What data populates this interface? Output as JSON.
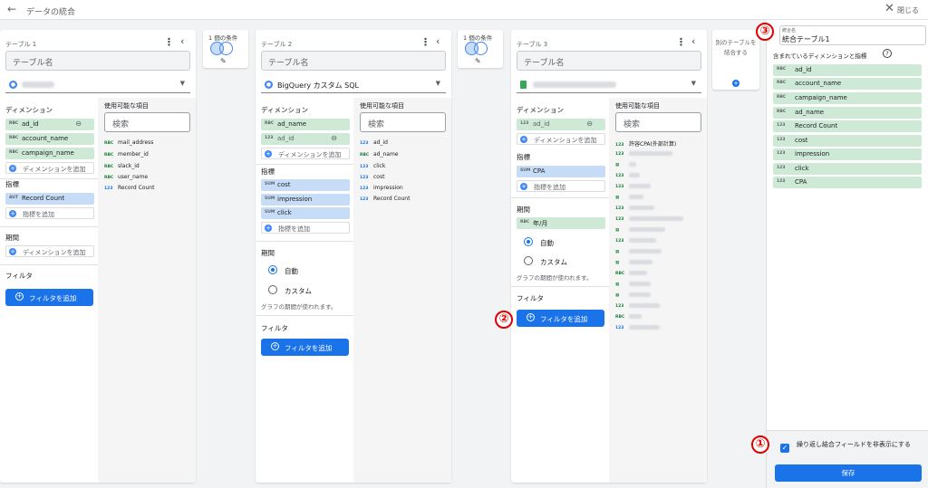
{
  "header": {
    "back_icon": "←",
    "title": "データの統合",
    "close_icon": "✕",
    "close_label": "閉じる"
  },
  "common": {
    "table_name_placeholder": "テーブル名",
    "dimension": "ディメンション",
    "available": "使用可能な項目",
    "search_placeholder": "検索",
    "add_dimension": "ディメンションを追加",
    "metric": "指標",
    "add_metric": "指標を追加",
    "period": "期間",
    "filter": "フィルタ",
    "add_filter": "フィルタを追加",
    "auto": "自動",
    "custom": "カスタム",
    "graph_period": "グラフの期間が使われます。"
  },
  "table1": {
    "title": "テーブル 1",
    "dims": [
      {
        "type": "RBC",
        "name": "ad_id"
      },
      {
        "type": "RBC",
        "name": "account_name"
      },
      {
        "type": "RBC",
        "name": "campaign_name"
      }
    ],
    "metrics": [
      {
        "type": "AUT",
        "name": "Record Count"
      }
    ],
    "fields": [
      {
        "type": "RBC",
        "name": "mail_address"
      },
      {
        "type": "RBC",
        "name": "member_id"
      },
      {
        "type": "RBC",
        "name": "slack_id"
      },
      {
        "type": "RBC",
        "name": "user_name"
      },
      {
        "type": "123",
        "name": "Record Count"
      }
    ]
  },
  "cond1": {
    "label": "1 個の条件"
  },
  "table2": {
    "title": "テーブル 2",
    "source": "BigQuery カスタム SQL",
    "dims": [
      {
        "type": "RBC",
        "name": "ad_name"
      },
      {
        "type": "123",
        "name": "ad_id"
      }
    ],
    "metrics": [
      {
        "type": "SUM",
        "name": "cost"
      },
      {
        "type": "SUM",
        "name": "impression"
      },
      {
        "type": "SUM",
        "name": "click"
      }
    ],
    "fields": [
      {
        "type": "123",
        "name": "ad_id"
      },
      {
        "type": "RBC",
        "name": "ad_name"
      },
      {
        "type": "123",
        "name": "click"
      },
      {
        "type": "123",
        "name": "cost"
      },
      {
        "type": "123",
        "name": "impression"
      },
      {
        "type": "123",
        "name": "Record Count"
      }
    ]
  },
  "cond2": {
    "label": "1 個の条件"
  },
  "table3": {
    "title": "テーブル 3",
    "dims": [
      {
        "type": "123",
        "name": "ad_id"
      }
    ],
    "metrics": [
      {
        "type": "SUM",
        "name": "CPA"
      }
    ],
    "period_field": {
      "type": "RBC",
      "name": "年/月"
    },
    "fields_first": {
      "type": "123",
      "name": "許容CPA(外部計算)"
    }
  },
  "addtable": {
    "label": "別のテーブルを結合する"
  },
  "right": {
    "name_label": "統合名",
    "name_value": "統合テーブル1",
    "included_label": "含まれているディメンションと指標",
    "help_icon": "?",
    "items": [
      {
        "type": "RBC",
        "name": "ad_id"
      },
      {
        "type": "RBC",
        "name": "account_name"
      },
      {
        "type": "RBC",
        "name": "campaign_name"
      },
      {
        "type": "RBC",
        "name": "ad_name"
      },
      {
        "type": "123",
        "name": "Record Count"
      },
      {
        "type": "123",
        "name": "cost"
      },
      {
        "type": "123",
        "name": "impression"
      },
      {
        "type": "123",
        "name": "click"
      },
      {
        "type": "123",
        "name": "CPA"
      }
    ],
    "checkbox_label": "繰り返し結合フィールドを非表示にする",
    "save": "保存"
  },
  "callouts": {
    "c1": "①",
    "c2": "②",
    "c3": "③"
  }
}
